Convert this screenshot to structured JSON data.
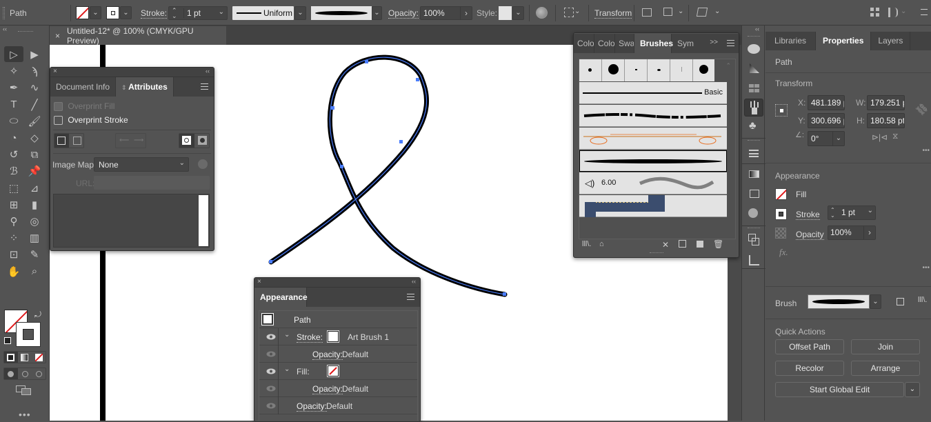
{
  "control_bar": {
    "selection_type": "Path",
    "stroke_label": "Stroke:",
    "stroke_weight": "1 pt",
    "variable_width_profile": "Uniform",
    "opacity_label": "Opacity:",
    "opacity_value": "100%",
    "style_label": "Style:",
    "transform_label": "Transform"
  },
  "document": {
    "tab_title": "Untitled-12* @ 100% (CMYK/GPU Preview)",
    "close_glyph": "×"
  },
  "attributes_panel": {
    "tabs": [
      "Document Info",
      "Attributes"
    ],
    "active_tab": "Attributes",
    "overprint_fill_label": "Overprint Fill",
    "overprint_stroke_label": "Overprint Stroke",
    "overprint_fill_checked": false,
    "overprint_stroke_checked": false,
    "image_map_label": "Image Map:",
    "image_map_value": "None",
    "url_label": "URL:",
    "url_value": ""
  },
  "brushes_panel": {
    "tabs": [
      "Colo",
      "Colo",
      "Swa",
      "Brushes",
      "Sym"
    ],
    "active_tab": "Brushes",
    "overflow_glyph": ">>",
    "basic_label": "Basic",
    "bristle_value": "6.00"
  },
  "appearance_panel": {
    "title": "Appearance",
    "object_label": "Path",
    "rows": [
      {
        "type": "stroke",
        "label": "Stroke:",
        "value": "Art Brush 1",
        "visible": true
      },
      {
        "type": "opacity-sub",
        "label": "Opacity:",
        "value": "Default",
        "visible": false
      },
      {
        "type": "fill",
        "label": "Fill:",
        "value": "",
        "visible": true
      },
      {
        "type": "opacity-sub",
        "label": "Opacity:",
        "value": "Default",
        "visible": false
      },
      {
        "type": "opacity",
        "label": "Opacity:",
        "value": "Default",
        "visible": false
      }
    ]
  },
  "right_panel": {
    "tabs": [
      "Libraries",
      "Properties",
      "Layers"
    ],
    "active_tab": "Properties",
    "object_type": "Path",
    "transform": {
      "title": "Transform",
      "x_label": "X:",
      "x_value": "481.189 p",
      "y_label": "Y:",
      "y_value": "300.696 p",
      "w_label": "W:",
      "w_value": "179.251 p",
      "h_label": "H:",
      "h_value": "180.58 pt",
      "angle_value": "0°"
    },
    "appearance": {
      "title": "Appearance",
      "fill_label": "Fill",
      "stroke_label": "Stroke",
      "stroke_weight": "1 pt",
      "opacity_label": "Opacity",
      "opacity_value": "100%",
      "fx_label": "fx."
    },
    "brush": {
      "label": "Brush"
    },
    "quick_actions": {
      "title": "Quick Actions",
      "buttons": [
        "Offset Path",
        "Join",
        "Recolor",
        "Arrange",
        "Start Global Edit"
      ]
    }
  },
  "colors": {
    "selection_blue": "#4a7dfc",
    "none_red": "#e0191b",
    "ui_bg": "#535353",
    "brush_orange": "#e86a1a"
  }
}
